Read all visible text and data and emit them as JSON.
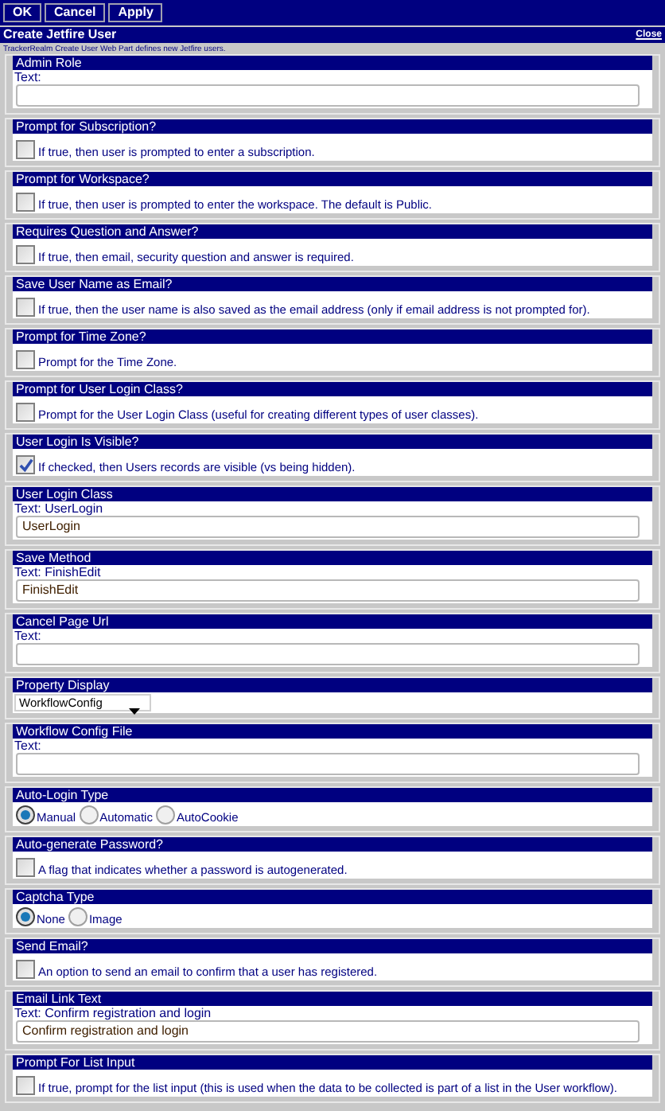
{
  "toolbar": {
    "buttons": [
      "OK",
      "Cancel",
      "Apply"
    ]
  },
  "title": "Create Jetfire User",
  "close_link": "Close",
  "subtitle": "TrackerRealm Create User Web Part defines new Jetfire users.",
  "sections": [
    {
      "kind": "text",
      "title": "Admin Role",
      "label": "Text:"
    },
    {
      "kind": "checkbox",
      "title": "Prompt for Subscription?",
      "checked": false,
      "description": "If true, then user is prompted to enter a subscription."
    },
    {
      "kind": "checkbox",
      "title": "Prompt for Workspace?",
      "checked": false,
      "description": "If true, then user is prompted to enter the workspace. The default is Public."
    },
    {
      "kind": "checkbox",
      "title": "Requires Question and Answer?",
      "checked": false,
      "description": "If true, then email, security question and answer is required."
    },
    {
      "kind": "checkbox",
      "title": "Save User Name as Email?",
      "checked": false,
      "description": "If true, then the user name is also saved as the email address (only if email address is not prompted for)."
    },
    {
      "kind": "checkbox",
      "title": "Prompt for Time Zone?",
      "checked": false,
      "description": "Prompt for the Time Zone."
    },
    {
      "kind": "checkbox",
      "title": "Prompt for User Login Class?",
      "checked": false,
      "description": "Prompt for the User Login Class (useful for creating different types of user classes)."
    },
    {
      "kind": "checkbox",
      "title": "User Login Is Visible?",
      "checked": true,
      "description": "If checked, then Users records are visible (vs being hidden)."
    },
    {
      "kind": "text",
      "title": "User Login Class",
      "label": "Text: UserLogin",
      "value": "UserLogin"
    },
    {
      "kind": "text",
      "title": "Save Method",
      "label": "Text: FinishEdit",
      "value": "FinishEdit"
    },
    {
      "kind": "text",
      "title": "Cancel Page Url",
      "label": "Text:"
    },
    {
      "kind": "select",
      "title": "Property Display",
      "value": "WorkflowConfig"
    },
    {
      "kind": "text",
      "title": "Workflow Config File",
      "label": "Text:"
    },
    {
      "kind": "radio",
      "title": "Auto-Login Type",
      "options": [
        {
          "label": "Manual",
          "selected": true
        },
        {
          "label": "Automatic",
          "selected": false
        },
        {
          "label": "AutoCookie",
          "selected": false
        }
      ]
    },
    {
      "kind": "checkbox",
      "title": "Auto-generate Password?",
      "checked": false,
      "description": "A flag that indicates whether a password is autogenerated."
    },
    {
      "kind": "radio",
      "title": "Captcha Type",
      "options": [
        {
          "label": "None",
          "selected": true
        },
        {
          "label": "Image",
          "selected": false
        }
      ]
    },
    {
      "kind": "checkbox",
      "title": "Send Email?",
      "checked": false,
      "description": "An option to send an email to confirm that a user has registered."
    },
    {
      "kind": "text",
      "title": "Email Link Text",
      "label": "Text: Confirm registration and login",
      "value": "Confirm registration and login"
    },
    {
      "kind": "checkbox",
      "title": "Prompt For List Input",
      "checked": false,
      "description": "If true, prompt for the list input (this is used when the data to be collected is part of a list in the User workflow)."
    }
  ]
}
